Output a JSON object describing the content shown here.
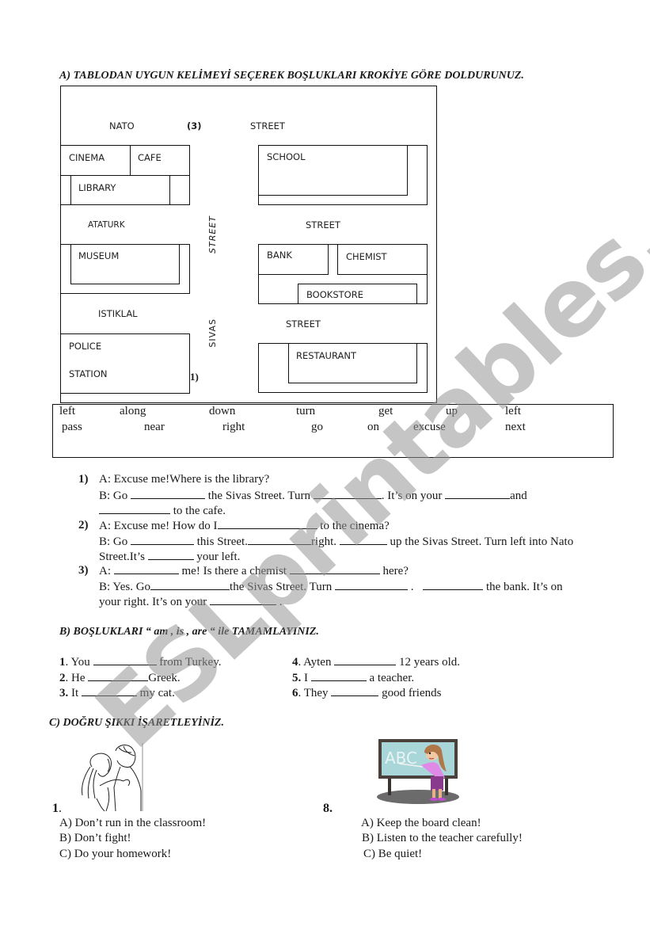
{
  "section_a": {
    "heading": "A) TABLODAN UYGUN KELİMEYİ SEÇEREK BOŞLUKLARI KROKİYE  GÖRE DOLDURUNUZ.",
    "map": {
      "streets": {
        "nato": "NATO",
        "nato_marker": "(3)",
        "nato_street": "STREET",
        "ataturk": "ATATURK",
        "ataturk_street": "STREET",
        "istiklal": "ISTIKLAL",
        "istiklal_street": "STREET",
        "sivas_street_upper": "STREET",
        "sivas": "SIVAS",
        "marker_1": "1)"
      },
      "buildings": {
        "cinema": "CINEMA",
        "cafe": "CAFE",
        "library": "LIBRARY",
        "school": "SCHOOL",
        "museum": "MUSEUM",
        "bank": "BANK",
        "chemist": "CHEMIST",
        "bookstore": "BOOKSTORE",
        "police": "POLICE",
        "station": "STATION",
        "restaurant": "RESTAURANT"
      }
    },
    "word_bank": {
      "row1": [
        "left",
        "along",
        "down",
        "turn",
        "get",
        "up",
        "left"
      ],
      "row2": [
        "pass",
        "near",
        "right",
        "go",
        "on",
        "excuse",
        "next"
      ]
    },
    "dialogues": [
      {
        "num": "1)",
        "a": "A: Excuse me!Where is the library?",
        "b_parts": [
          "B: Go",
          "the Sivas Street. Turn",
          ". It’s on your",
          "and"
        ],
        "c_parts": [
          "to the cafe."
        ]
      },
      {
        "num": "2)",
        "a_parts": [
          "A: Excuse me!  How do I",
          "to the cinema?"
        ],
        "b_parts": [
          "B: Go",
          "this  Street.",
          "right.",
          "up the Sivas Street. Turn left into Nato"
        ],
        "c_parts": [
          "Street.It’s",
          "your left."
        ]
      },
      {
        "num": "3)",
        "a_parts": [
          "A:",
          "me! Is there a chemist",
          "here?"
        ],
        "b_parts": [
          "B: Yes. Go",
          "the Sivas Street. Turn",
          ".",
          "the bank. It’s on"
        ],
        "c_parts": [
          "your  right. It’s on your",
          "."
        ]
      }
    ]
  },
  "section_b": {
    "heading": "B) BOŞLUKLARI “ am , is , are “ ile TAMAMLAYINIZ.",
    "items": [
      {
        "num": "1",
        "before": ". You",
        "after": "from Turkey."
      },
      {
        "num": "2",
        "before": ". He",
        "after": "Greek."
      },
      {
        "num": "3.",
        "before": " It",
        "after": "my cat."
      },
      {
        "num": "4",
        "before": ". Ayten",
        "after": "12 years old."
      },
      {
        "num": "5.",
        "before": " I",
        "after": "a teacher."
      },
      {
        "num": "6",
        "before": ".  They",
        "after": "good friends"
      }
    ]
  },
  "section_c": {
    "heading": "C) DOĞRU ŞIKKI İŞARETLEYİNİZ.",
    "questions": [
      {
        "num": "1",
        "num_suffix": ".",
        "image": "children-fighting-illustration",
        "options": [
          "A) Don’t run in the classroom!",
          "B) Don’t fight!",
          "C) Do your homework!"
        ]
      },
      {
        "num": "8.",
        "image": "teacher-at-board-illustration",
        "board_text": "ABC",
        "options": [
          "A) Keep the board clean!",
          "B) Listen to the teacher carefully!",
          "C) Be quiet!"
        ]
      }
    ]
  },
  "watermark": "ESLprintables.com"
}
